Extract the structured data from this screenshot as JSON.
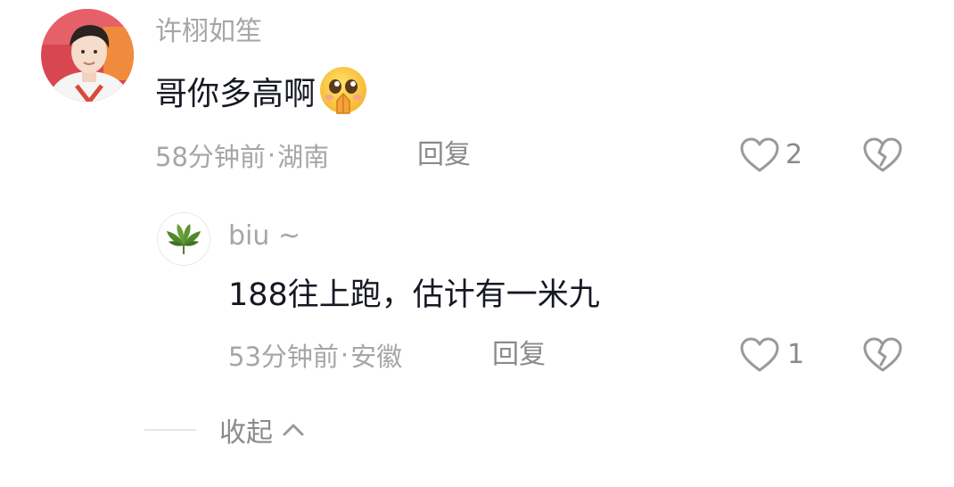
{
  "comment": {
    "username": "许栩如笙",
    "text": "哥你多高啊",
    "emoji_icon": "pleading-face-emoji-icon",
    "time": "58分钟前",
    "separator": "·",
    "location": "湖南",
    "reply_label": "回复",
    "like_count": "2"
  },
  "reply": {
    "username": "biu ~",
    "text": "188往上跑，估计有一米九",
    "time": "53分钟前",
    "separator": "·",
    "location": "安徽",
    "reply_label": "回复",
    "like_count": "1"
  },
  "collapse": {
    "label": "收起"
  },
  "icons": {
    "like": "heart-outline-icon",
    "dislike": "broken-heart-icon",
    "chevron": "chevron-up-icon"
  },
  "colors": {
    "text_primary": "#161823",
    "text_secondary": "#a6a6a6",
    "icon_gray": "#9a9a9a"
  }
}
